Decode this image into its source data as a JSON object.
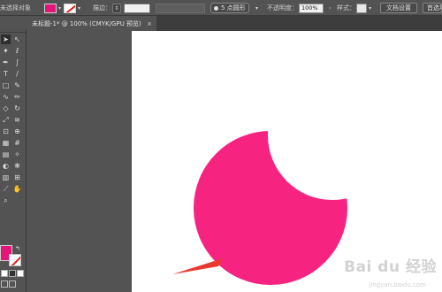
{
  "control_bar": {
    "selection_label": "未选择对象",
    "stroke_label": "描边：",
    "brush_label": "5 点圆形",
    "opacity_label": "不透明度：",
    "opacity_value": "100%",
    "style_label": "样式：",
    "doc_settings_button": "文档设置",
    "prefs_button": "首选项",
    "fill_color": "#e5167a"
  },
  "document_tab": {
    "title": "未标题-1* @ 100% (CMYK/GPU 预览)",
    "close_glyph": "×"
  },
  "toolbar": {
    "fill_color": "#e5167a",
    "stroke_color": "#ffffff"
  },
  "canvas": {
    "shape_color": "#f72381",
    "pointer_color": "#e8382f"
  },
  "watermark": {
    "text": "Bai du 经验",
    "sub": "jingyan.baidu.com"
  }
}
